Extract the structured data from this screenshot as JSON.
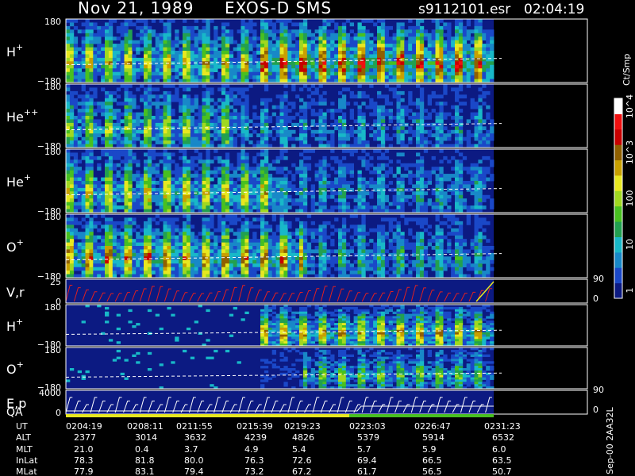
{
  "header": {
    "date": "Nov 21, 1989",
    "instrument": "EXOS-D SMS",
    "file": "s9112101.esr",
    "time": "02:04:19"
  },
  "chart_data": {
    "type": "heatmap",
    "colorbar": {
      "unit": "Ct/Smp",
      "scale": "log",
      "ticks": [
        "1",
        "10",
        "100",
        "10^3",
        "10^4"
      ],
      "colors": [
        "#0c1a82",
        "#1a48c8",
        "#1888c8",
        "#18b8c8",
        "#22a050",
        "#48c020",
        "#a0d820",
        "#e8e820",
        "#c8a000",
        "#906000",
        "#c80000",
        "#f01010",
        "#ffffff"
      ]
    },
    "panels": [
      {
        "label": "H",
        "sup": "+",
        "ymax": "180",
        "ymin": "−180",
        "kind": "pitch"
      },
      {
        "label": "He",
        "sup": "++",
        "ymax": "180",
        "ymin": "−180",
        "kind": "pitch"
      },
      {
        "label": "He",
        "sup": "+",
        "ymax": "180",
        "ymin": "−180",
        "kind": "pitch"
      },
      {
        "label": "O",
        "sup": "+",
        "ymax": "180",
        "ymin": "−180",
        "kind": "pitch"
      },
      {
        "label": "V,r",
        "sup": "",
        "ymax": "25",
        "ymin": "0",
        "right_top": "90",
        "right_bottom": "0",
        "kind": "line"
      },
      {
        "label": "H",
        "sup": "+",
        "ymax": "180",
        "ymin": "−180",
        "kind": "pitch"
      },
      {
        "label": "O",
        "sup": "+",
        "ymax": "180",
        "ymin": "−180",
        "kind": "pitch"
      },
      {
        "label": "E,p",
        "label2": "QA",
        "sup": "",
        "ymax": "4000",
        "ymin": "0",
        "right_top": "90",
        "right_bottom": "0",
        "kind": "line"
      }
    ],
    "table": {
      "row_labels": [
        "UT",
        "ALT",
        "MLT",
        "InLat",
        "MLat"
      ],
      "columns": [
        [
          "0204:19",
          "2377",
          "21.0",
          "78.3",
          "77.9"
        ],
        [
          "0208:11",
          "3014",
          "0.4",
          "81.8",
          "83.1"
        ],
        [
          "0211:55",
          "3632",
          "3.7",
          "80.0",
          "79.4"
        ],
        [
          "0215:39",
          "4239",
          "4.9",
          "76.3",
          "73.2"
        ],
        [
          "0219:23",
          "4826",
          "5.4",
          "72.6",
          "67.2"
        ],
        [
          "0223:03",
          "5379",
          "5.7",
          "69.4",
          "61.7"
        ],
        [
          "0226:47",
          "5914",
          "5.9",
          "66.5",
          "56.5"
        ],
        [
          "0231:23",
          "6532",
          "6.0",
          "63.5",
          "50.7"
        ]
      ]
    },
    "footer_label": "Sep-00 2AA32L"
  }
}
